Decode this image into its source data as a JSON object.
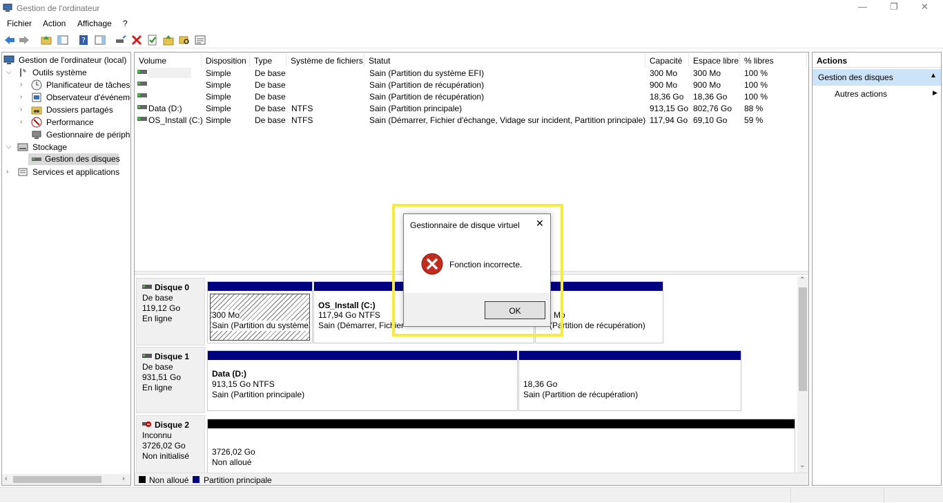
{
  "window": {
    "title": "Gestion de l'ordinateur",
    "minimize": "—",
    "restore": "❐",
    "close": "✕"
  },
  "menu": [
    "Fichier",
    "Action",
    "Affichage",
    "?"
  ],
  "tree": {
    "root": "Gestion de l'ordinateur (local)",
    "outils": "Outils système",
    "planificateur": "Planificateur de tâches",
    "observateur": "Observateur d'événements",
    "dossiers": "Dossiers partagés",
    "performance": "Performance",
    "peripheriques": "Gestionnaire de périphériques",
    "stockage": "Stockage",
    "gestion_disques": "Gestion des disques",
    "services": "Services et applications"
  },
  "volume_table": {
    "headers": [
      "Volume",
      "Disposition",
      "Type",
      "Système de fichiers",
      "Statut",
      "Capacité",
      "Espace libre",
      "% libres"
    ],
    "rows": [
      [
        "",
        "Simple",
        "De base",
        "",
        "Sain (Partition du système EFI)",
        "300 Mo",
        "300 Mo",
        "100 %"
      ],
      [
        "",
        "Simple",
        "De base",
        "",
        "Sain (Partition de récupération)",
        "900 Mo",
        "900 Mo",
        "100 %"
      ],
      [
        "",
        "Simple",
        "De base",
        "",
        "Sain (Partition de récupération)",
        "18,36 Go",
        "18,36 Go",
        "100 %"
      ],
      [
        "Data (D:)",
        "Simple",
        "De base",
        "NTFS",
        "Sain (Partition principale)",
        "913,15 Go",
        "802,76 Go",
        "88 %"
      ],
      [
        "OS_Install (C:)",
        "Simple",
        "De base",
        "NTFS",
        "Sain (Démarrer, Fichier d'échange, Vidage sur incident, Partition principale)",
        "117,94 Go",
        "69,10 Go",
        "59 %"
      ]
    ]
  },
  "disks": {
    "disk0": {
      "name": "Disque 0",
      "type": "De base",
      "size": "119,12 Go",
      "state": "En ligne",
      "p1": {
        "size": "300 Mo",
        "status": "Sain (Partition du système"
      },
      "p2": {
        "name": "OS_Install  (C:)",
        "size": "117,94 Go NTFS",
        "status": "Sain (Démarrer, Fichier"
      },
      "p3": {
        "size": "Mo",
        "status": "(Partition de récupération)"
      }
    },
    "disk1": {
      "name": "Disque 1",
      "type": "De base",
      "size": "931,51 Go",
      "state": "En ligne",
      "p1": {
        "name": "Data  (D:)",
        "size": "913,15 Go NTFS",
        "status": "Sain (Partition principale)"
      },
      "p2": {
        "size": "18,36 Go",
        "status": "Sain (Partition de récupération)"
      }
    },
    "disk2": {
      "name": "Disque 2",
      "type": "Inconnu",
      "size": "3726,02 Go",
      "state": "Non initialisé",
      "p1": {
        "size": "3726,02 Go",
        "status": "Non alloué"
      }
    }
  },
  "legend": {
    "unallocated": "Non alloué",
    "primary": "Partition principale"
  },
  "actions": {
    "title": "Actions",
    "section": "Gestion des disques",
    "more": "Autres actions"
  },
  "dialog": {
    "title": "Gestionnaire de disque virtuel",
    "message": "Fonction incorrecte.",
    "ok": "OK"
  },
  "colors": {
    "primary_partition": "#000080",
    "unallocated": "#000000",
    "highlight": "#f5ec3b",
    "actions_header": "#cde3f7"
  }
}
